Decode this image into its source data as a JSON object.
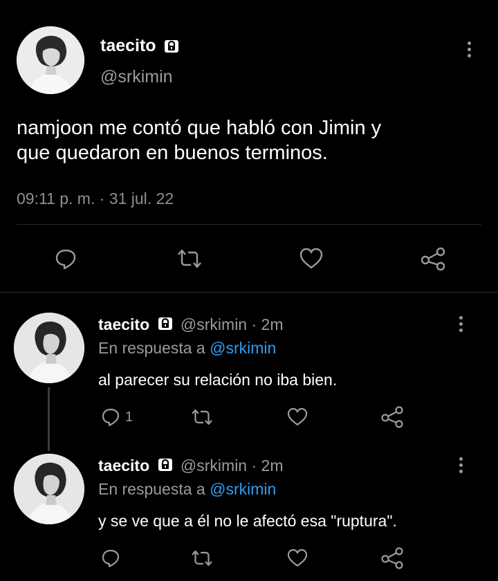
{
  "main_tweet": {
    "display_name": "taecito",
    "handle": "@srkimin",
    "text_line_1": "namjoon me contó que habló con Jimin y",
    "text_line_2": "que quedaron en buenos terminos.",
    "timestamp": "09:11 p. m. · 31 jul. 22",
    "icons": [
      "lock-icon",
      "more-vertical-icon",
      "reply-icon",
      "retweet-icon",
      "like-icon",
      "share-icon"
    ]
  },
  "replies": [
    {
      "display_name": "taecito",
      "handle_time": "@srkimin · 2m",
      "reply_prefix": "En respuesta a",
      "reply_mention": "@srkimin",
      "text": "al parecer su relación no iba bien.",
      "reply_count": "1"
    },
    {
      "display_name": "taecito",
      "handle_time": "@srkimin · 2m",
      "reply_prefix": "En respuesta a",
      "reply_mention": "@srkimin",
      "text": "y se ve que a él no le afectó esa \"ruptura\".",
      "reply_count": ""
    }
  ],
  "colors": {
    "background": "#000000",
    "text": "#ffffff",
    "muted": "#9b9b9b",
    "link": "#2f9cf2",
    "divider": "#2b2b2b"
  }
}
